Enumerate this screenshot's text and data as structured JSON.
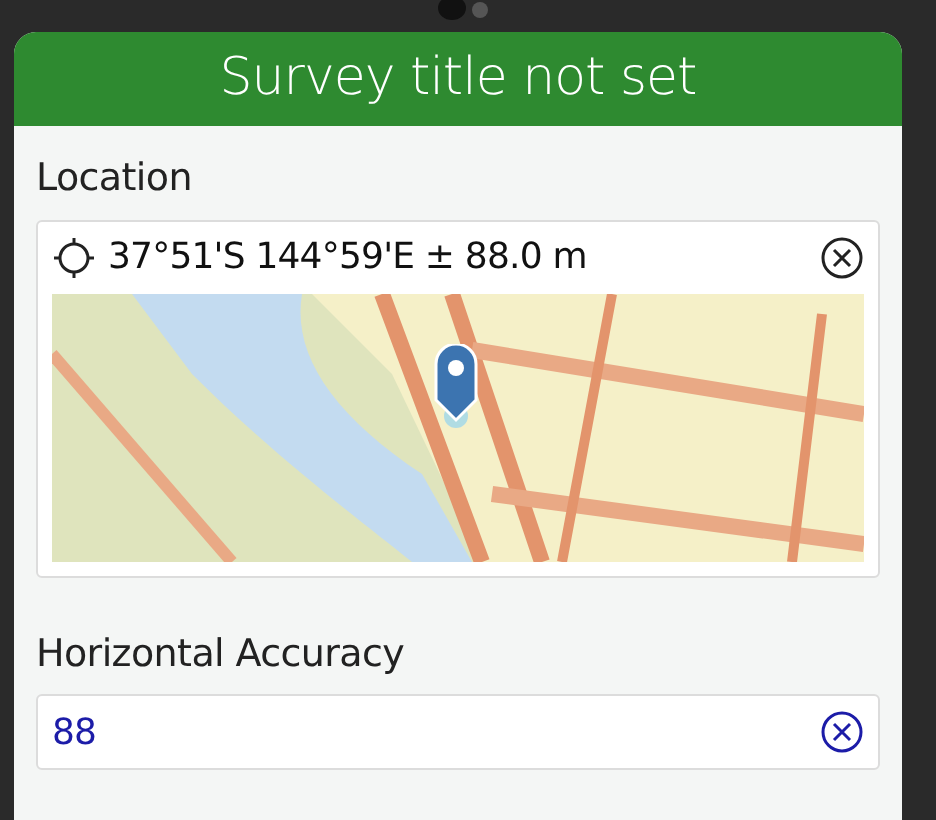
{
  "header": {
    "title": "Survey title not set"
  },
  "fields": [
    {
      "kind": "geopoint",
      "label": "Location",
      "value": "37°51'S 144°59'E ± 88.0 m"
    },
    {
      "kind": "number",
      "label": "Horizontal Accuracy",
      "value": "88"
    }
  ]
}
